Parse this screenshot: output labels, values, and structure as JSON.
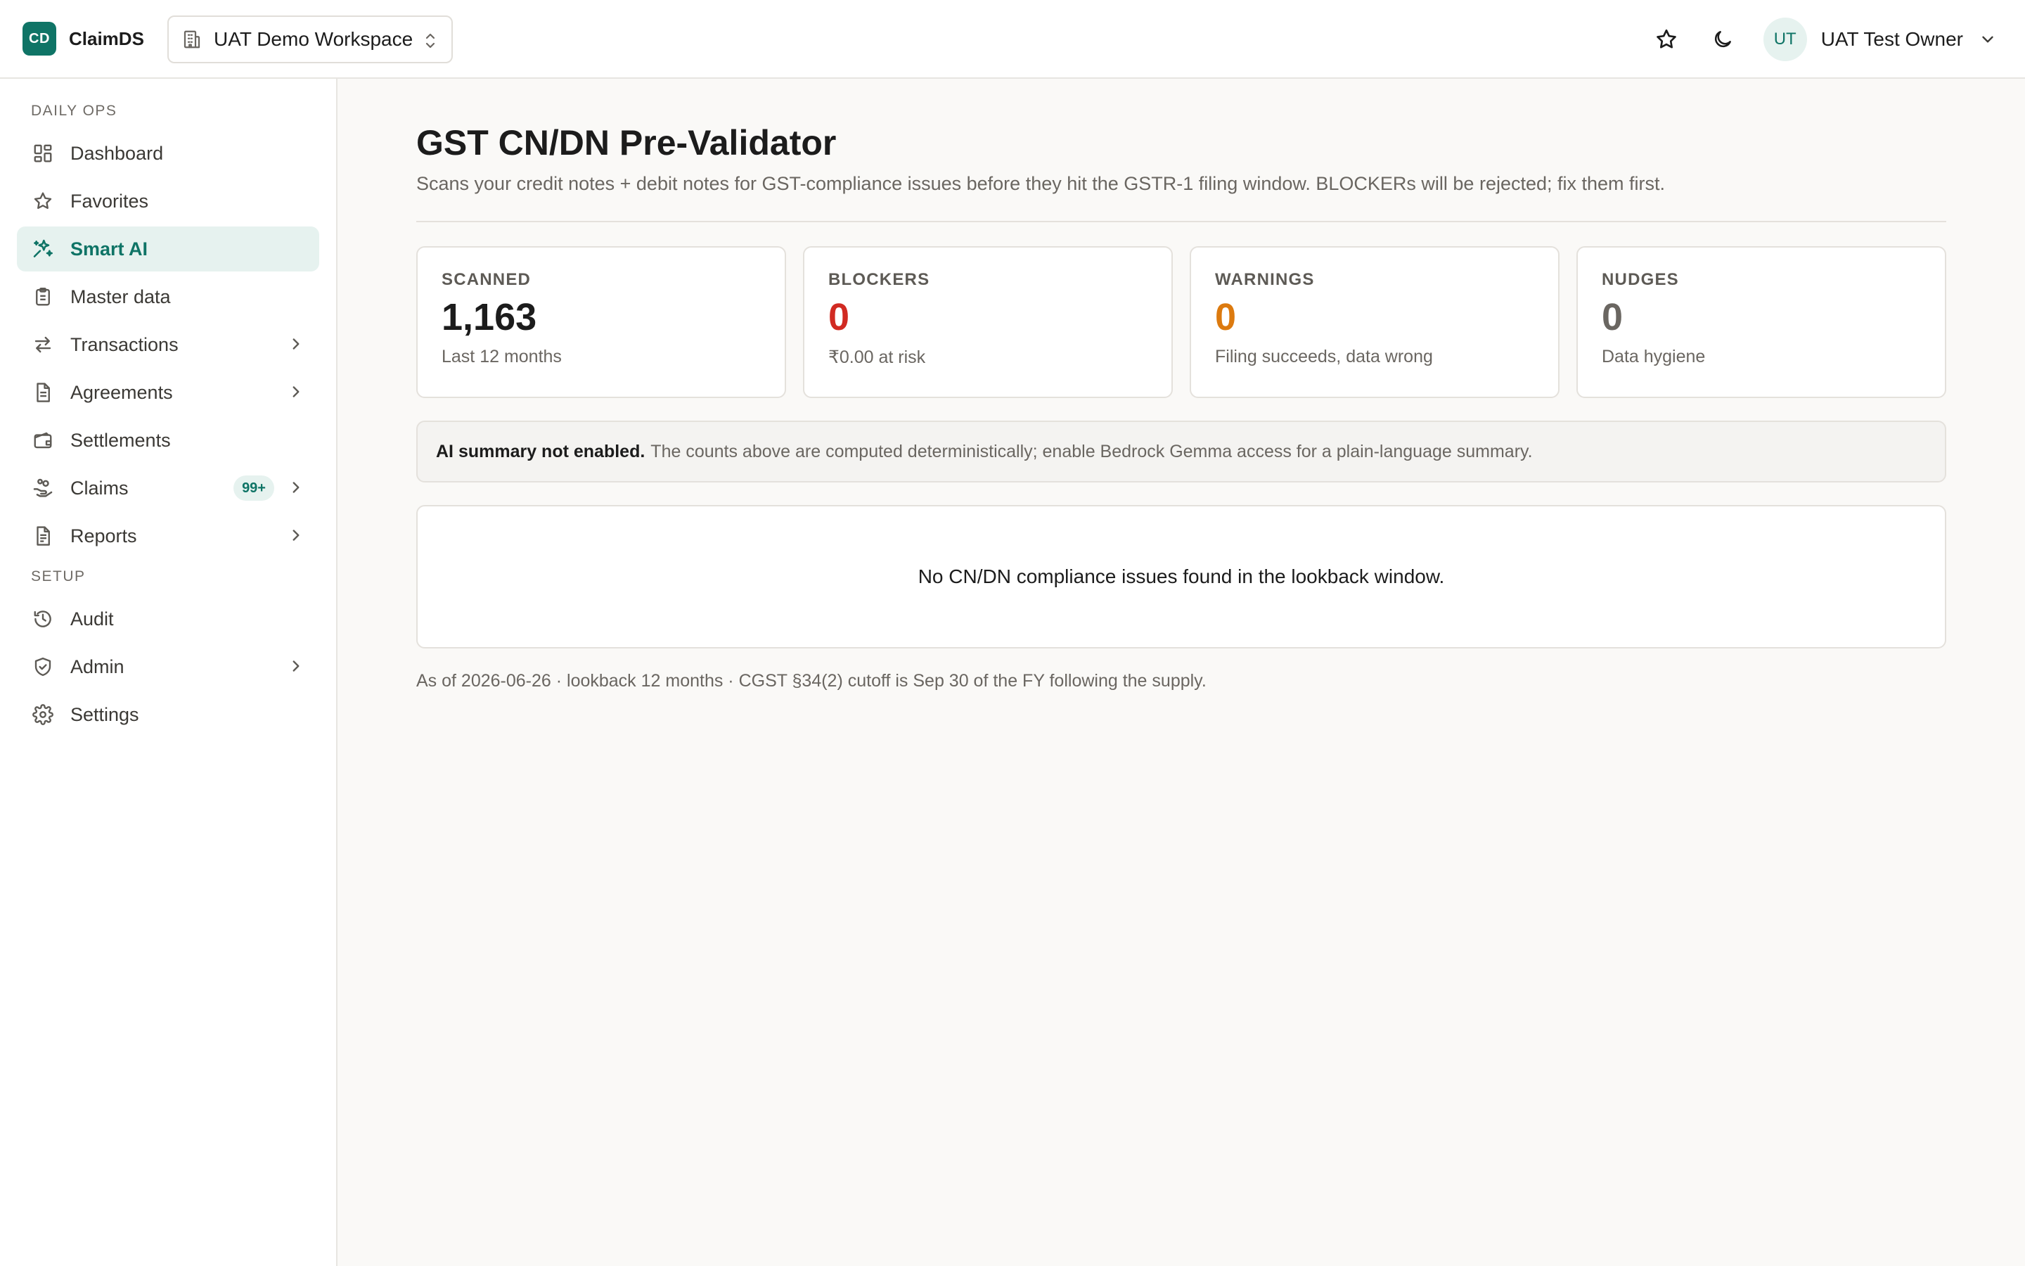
{
  "app": {
    "logo_text": "CD",
    "name": "ClaimDS"
  },
  "workspace": {
    "label": "UAT Demo Workspace"
  },
  "user": {
    "initials": "UT",
    "name": "UAT Test Owner"
  },
  "sidebar": {
    "sections": [
      {
        "label": "DAILY OPS",
        "items": [
          {
            "label": "Dashboard",
            "icon": "dashboard-grid-icon"
          },
          {
            "label": "Favorites",
            "icon": "star-icon"
          },
          {
            "label": "Smart AI",
            "icon": "sparkles-icon",
            "active": true
          },
          {
            "label": "Master data",
            "icon": "clipboard-icon"
          },
          {
            "label": "Transactions",
            "icon": "arrows-swap-icon",
            "expandable": true
          },
          {
            "label": "Agreements",
            "icon": "document-icon",
            "expandable": true
          },
          {
            "label": "Settlements",
            "icon": "wallet-icon"
          },
          {
            "label": "Claims",
            "icon": "hand-coins-icon",
            "badge": "99+",
            "expandable": true
          },
          {
            "label": "Reports",
            "icon": "report-icon",
            "expandable": true
          }
        ]
      },
      {
        "label": "SETUP",
        "items": [
          {
            "label": "Audit",
            "icon": "history-icon"
          },
          {
            "label": "Admin",
            "icon": "shield-check-icon",
            "expandable": true
          },
          {
            "label": "Settings",
            "icon": "gear-icon"
          }
        ]
      }
    ]
  },
  "page": {
    "title": "GST CN/DN Pre-Validator",
    "subtitle": "Scans your credit notes + debit notes for GST-compliance issues before they hit the GSTR-1 filing window. BLOCKERs will be rejected; fix them first."
  },
  "stats": [
    {
      "label": "SCANNED",
      "value": "1,163",
      "note": "Last 12 months",
      "color": "#1c1c1c"
    },
    {
      "label": "BLOCKERS",
      "value": "0",
      "note": "₹0.00 at risk",
      "color": "#d12a22"
    },
    {
      "label": "WARNINGS",
      "value": "0",
      "note": "Filing succeeds, data wrong",
      "color": "#dc7a0f"
    },
    {
      "label": "NUDGES",
      "value": "0",
      "note": "Data hygiene",
      "color": "#6a6661"
    }
  ],
  "ai_summary": {
    "title": "AI summary not enabled.",
    "text": "The counts above are computed deterministically; enable Bedrock Gemma access for a plain-language summary."
  },
  "empty_state": {
    "text": "No CN/DN compliance issues found in the lookback window."
  },
  "footnote": "As of 2026-06-26 · lookback 12 months · CGST §34(2) cutoff is Sep 30 of the FY following the supply.",
  "colors": {
    "accent": "#0f7466",
    "blocker": "#d12a22",
    "warning": "#dc7a0f"
  }
}
